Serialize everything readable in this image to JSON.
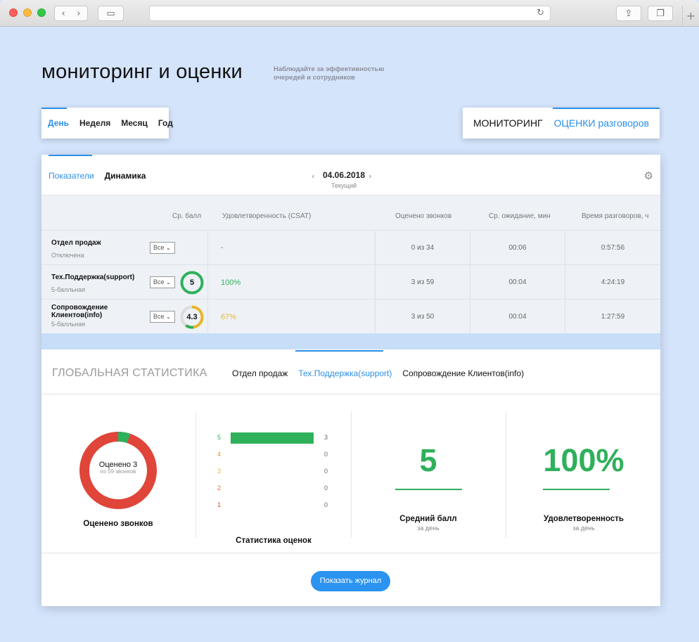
{
  "header": {
    "title": "мониторинг и оценки",
    "subtitle": "Наблюдайте за эффективностью очередей и сотрудников"
  },
  "period_tabs": [
    {
      "label": "День",
      "active": true
    },
    {
      "label": "Неделя",
      "active": false
    },
    {
      "label": "Месяц",
      "active": false
    },
    {
      "label": "Год",
      "active": false
    }
  ],
  "mode_tabs": [
    {
      "label": "МОНИТОРИНГ",
      "active": false
    },
    {
      "label": "ОЦЕНКИ разговоров",
      "active": true
    }
  ],
  "sub_tabs": [
    {
      "label": "Показатели",
      "active": true
    },
    {
      "label": "Динамика",
      "active": false
    }
  ],
  "date_nav": {
    "date": "04.06.2018",
    "label": "Текущий",
    "prev_icon": "chevron-left-icon",
    "next_icon": "chevron-right-icon"
  },
  "settings_icon": "gear-icon",
  "table": {
    "columns": [
      "Ср. балл",
      "Удовлетворенность (CSAT)",
      "Оценено звонков",
      "Ср. ожидание, мин",
      "Время разговоров, ч"
    ],
    "rows": [
      {
        "dept": "Отдел продаж",
        "status": "Отключена",
        "filter": "Все",
        "score": "",
        "score_fraction": 0,
        "csat": "-",
        "rated": "0 из 34",
        "wait": "00:06",
        "talk": "0:57:56"
      },
      {
        "dept": "Тех.Поддержка(support)",
        "status": "5-балльная",
        "filter": "Все",
        "score": "5",
        "score_fraction": 1.0,
        "csat": "100%",
        "rated": "3 из 59",
        "wait": "00:04",
        "talk": "4:24:19"
      },
      {
        "dept": "Сопровождение Клиентов(info)",
        "status": "5-балльная",
        "filter": "Все",
        "score": "4.3",
        "score_fraction": 0.6,
        "csat": "67%",
        "rated": "3 из 50",
        "wait": "00:04",
        "talk": "1:27:59"
      }
    ]
  },
  "global_stats": {
    "title": "ГЛОБАЛЬНАЯ СТАТИСТИКА",
    "tabs": [
      {
        "label": "Отдел продаж",
        "active": false
      },
      {
        "label": "Тех.Поддержка(support)",
        "active": true
      },
      {
        "label": "Сопровождение Клиентов(info)",
        "active": false
      }
    ],
    "rated": {
      "main": "Оценено 3",
      "sub": "из 59 звонков",
      "label": "Оценено звонков",
      "rated": 3,
      "total": 59
    },
    "distribution": {
      "label": "Статистика оценок",
      "rows": [
        {
          "score": "5",
          "count": "3",
          "color": "#2fb05a"
        },
        {
          "score": "4",
          "count": "0",
          "color": "#e8902a"
        },
        {
          "score": "3",
          "count": "0",
          "color": "#e8b52a"
        },
        {
          "score": "2",
          "count": "0",
          "color": "#e86a2a"
        },
        {
          "score": "1",
          "count": "0",
          "color": "#d9452a"
        }
      ]
    },
    "avg_score": {
      "value": "5",
      "label": "Средний балл",
      "sub": "за день"
    },
    "satisfaction": {
      "value": "100%",
      "label": "Удовлетворенность",
      "sub": "за день"
    }
  },
  "journal_button": "Показать журнал",
  "colors": {
    "accent": "#2c8fe8",
    "green": "#2fb05a",
    "yellow": "#e8b52a",
    "red": "#e0453a"
  }
}
